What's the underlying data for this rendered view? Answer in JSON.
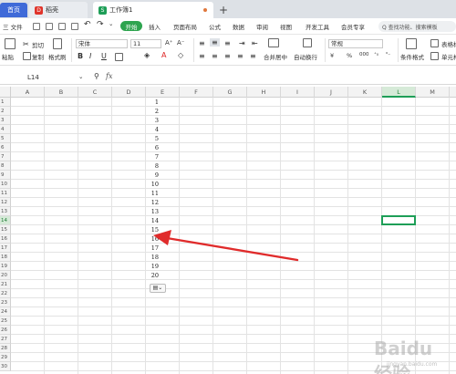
{
  "tabs": [
    {
      "label": "首页"
    },
    {
      "label": "稻壳"
    },
    {
      "label": "工作簿1"
    }
  ],
  "menu": {
    "file": "三 文件",
    "start": "开始",
    "items": [
      "插入",
      "页面布局",
      "公式",
      "数据",
      "审阅",
      "视图",
      "开发工具",
      "会员专享"
    ],
    "search": "Q 查找功能、搜索模板"
  },
  "ribbon": {
    "paste": "粘贴",
    "cut": "剪切",
    "copy": "复制",
    "format_painter": "格式刷",
    "font": "宋体",
    "font_size": "11",
    "bold": "B",
    "italic": "I",
    "underline": "U",
    "merge_center": "合并居中",
    "wrap": "自动换行",
    "number_format": "常规",
    "currency": "¥",
    "percent": "%",
    "thousands": "000",
    "cond_format": "条件格式",
    "table_style": "表格样",
    "cell_style": "单元格"
  },
  "formula_bar": {
    "cell_ref": "L14",
    "fx": "fx"
  },
  "columns": [
    "A",
    "B",
    "C",
    "D",
    "E",
    "F",
    "G",
    "H",
    "I",
    "J",
    "K",
    "L",
    "M"
  ],
  "rows": [
    "1",
    "2",
    "3",
    "4",
    "5",
    "6",
    "7",
    "8",
    "9",
    "10",
    "11",
    "12",
    "13",
    "14",
    "15",
    "16",
    "17",
    "18",
    "19",
    "20",
    "21",
    "22",
    "23",
    "24",
    "25",
    "26",
    "27",
    "28",
    "29",
    "30"
  ],
  "active_column": "L",
  "active_row": "14",
  "column_d_values": [
    "1",
    "2",
    "3",
    "4",
    "5",
    "6",
    "7",
    "8",
    "9",
    "10",
    "11",
    "12",
    "13",
    "14",
    "15",
    "16",
    "17",
    "18",
    "19",
    "20"
  ],
  "watermark": {
    "brand": "Baidu 经验",
    "sub": "jingyan.baidu.com"
  },
  "colors": {
    "accent_green": "#1e9e57",
    "tab_blue": "#3f6ad8",
    "arrow_red": "#e02b2b"
  }
}
